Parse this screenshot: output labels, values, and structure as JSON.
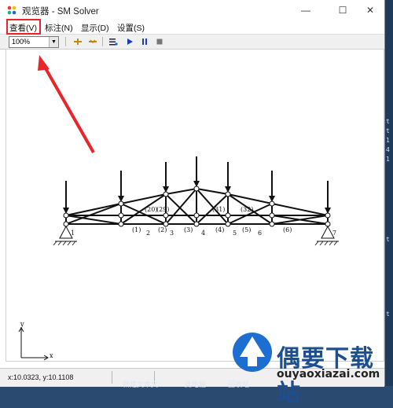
{
  "window": {
    "title": "观览器 - SM Solver",
    "minimize_glyph": "—",
    "maximize_glyph": "☐",
    "close_glyph": "✕"
  },
  "menu": {
    "items": [
      {
        "label": "查看(V)",
        "highlighted": true
      },
      {
        "label": "标注(N)"
      },
      {
        "label": "显示(D)"
      },
      {
        "label": "设置(S)"
      }
    ]
  },
  "toolbar": {
    "zoom_value": "100%",
    "icons": [
      "add-load-icon",
      "remove-load-icon",
      "settings-icon",
      "play-icon",
      "pause-icon",
      "stop-icon"
    ]
  },
  "axes": {
    "y_label": "y",
    "x_label": "x"
  },
  "truss": {
    "top_labels": [
      "(20)",
      "(29)",
      "(31)",
      "(32)"
    ],
    "bottom_labels": [
      "1",
      "2",
      "3",
      "4",
      "5",
      "6",
      "7"
    ],
    "lower_member_labels": [
      "(1)",
      "(2)",
      "(3)",
      "(4)",
      "(5)",
      "(6)"
    ]
  },
  "status": {
    "coords": "x:10.0323,  y:10.1108"
  },
  "desktop": {
    "right_edge_text": [
      "t",
      "t",
      "1",
      "4",
      "1",
      "t",
      "t"
    ],
    "taskbar": [
      "新建文本文",
      "此电脑",
      "回收站"
    ]
  },
  "watermark": {
    "text": "偶要下载站",
    "url": "ouyaoxiazai.com"
  },
  "colors": {
    "highlight": "#e8252a",
    "arrow": "#e8252a",
    "watermark_blue": "#1c6fd0"
  }
}
